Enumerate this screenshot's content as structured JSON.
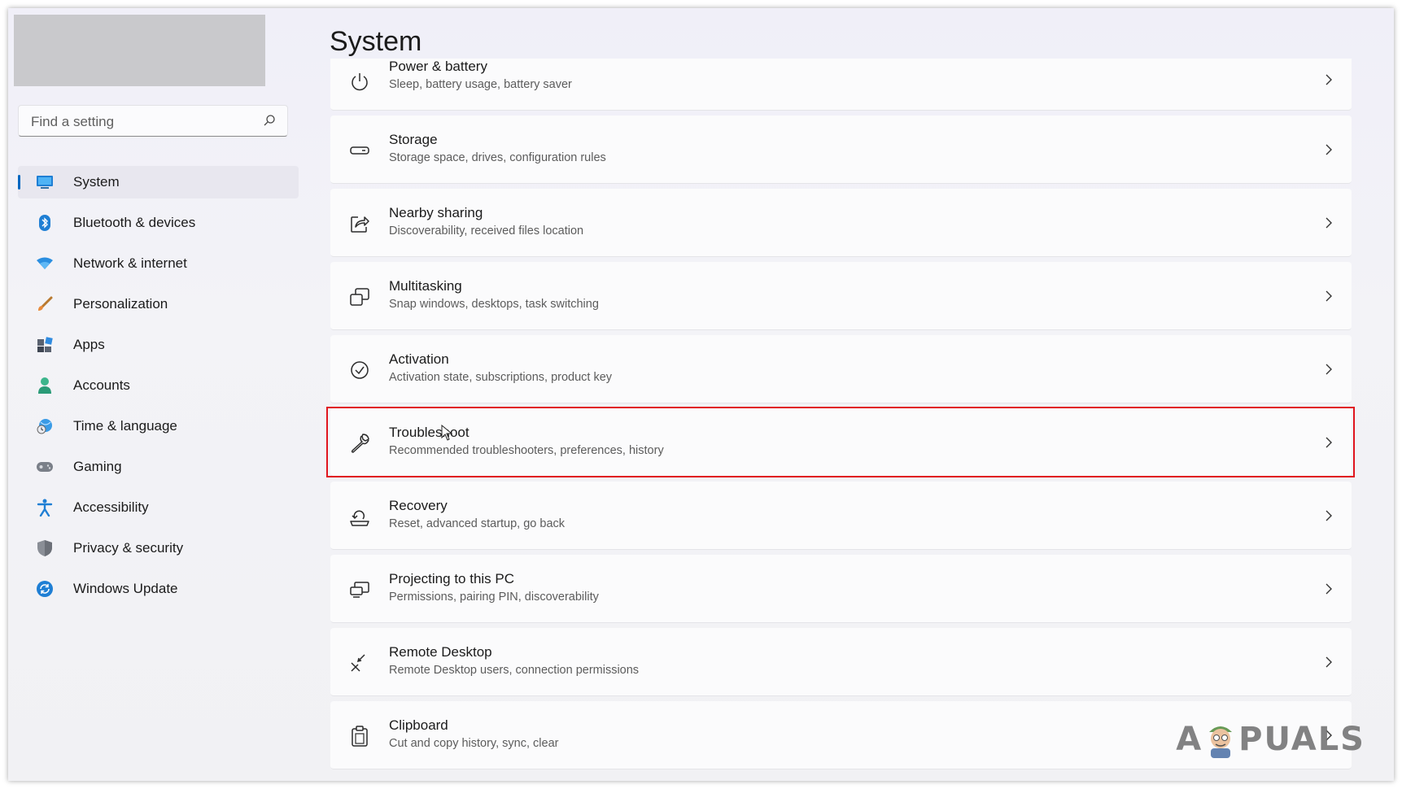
{
  "search": {
    "placeholder": "Find a setting"
  },
  "sidebar": {
    "items": [
      {
        "label": "System",
        "icon": "system-icon",
        "selected": true
      },
      {
        "label": "Bluetooth & devices",
        "icon": "bluetooth-icon"
      },
      {
        "label": "Network & internet",
        "icon": "wifi-icon"
      },
      {
        "label": "Personalization",
        "icon": "brush-icon"
      },
      {
        "label": "Apps",
        "icon": "apps-icon"
      },
      {
        "label": "Accounts",
        "icon": "person-icon"
      },
      {
        "label": "Time & language",
        "icon": "globe-clock-icon"
      },
      {
        "label": "Gaming",
        "icon": "gamepad-icon"
      },
      {
        "label": "Accessibility",
        "icon": "accessibility-icon"
      },
      {
        "label": "Privacy & security",
        "icon": "shield-icon"
      },
      {
        "label": "Windows Update",
        "icon": "update-icon"
      }
    ]
  },
  "main": {
    "title": "System",
    "cards": [
      {
        "title": "Power & battery",
        "subtitle": "Sleep, battery usage, battery saver",
        "icon": "power-icon"
      },
      {
        "title": "Storage",
        "subtitle": "Storage space, drives, configuration rules",
        "icon": "storage-icon"
      },
      {
        "title": "Nearby sharing",
        "subtitle": "Discoverability, received files location",
        "icon": "share-icon"
      },
      {
        "title": "Multitasking",
        "subtitle": "Snap windows, desktops, task switching",
        "icon": "multitasking-icon"
      },
      {
        "title": "Activation",
        "subtitle": "Activation state, subscriptions, product key",
        "icon": "check-circle-icon"
      },
      {
        "title": "Troubleshoot",
        "subtitle": "Recommended troubleshooters, preferences, history",
        "icon": "wrench-icon",
        "highlighted": true
      },
      {
        "title": "Recovery",
        "subtitle": "Reset, advanced startup, go back",
        "icon": "recovery-icon"
      },
      {
        "title": "Projecting to this PC",
        "subtitle": "Permissions, pairing PIN, discoverability",
        "icon": "projecting-icon"
      },
      {
        "title": "Remote Desktop",
        "subtitle": "Remote Desktop users, connection permissions",
        "icon": "remote-desktop-icon"
      },
      {
        "title": "Clipboard",
        "subtitle": "Cut and copy history, sync, clear",
        "icon": "clipboard-icon"
      }
    ]
  },
  "watermark": {
    "text_left": "A",
    "text_right": "PUALS"
  },
  "colors": {
    "accent": "#0067c0",
    "highlight": "#e0151e"
  }
}
